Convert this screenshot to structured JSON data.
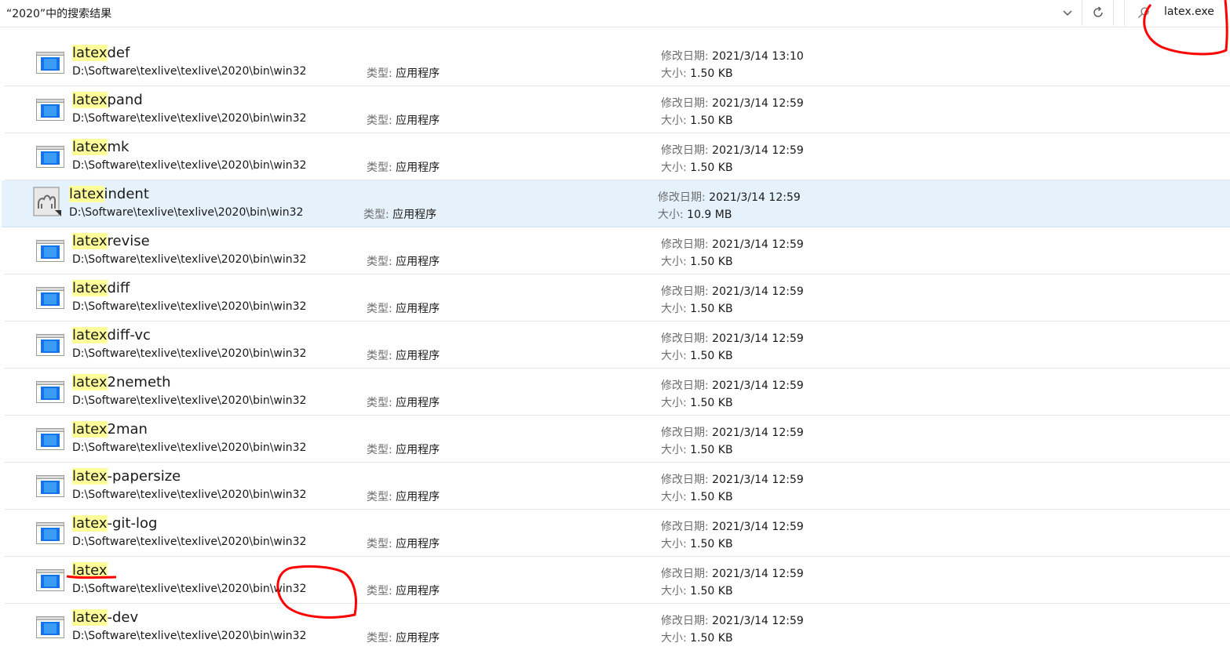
{
  "address_bar": {
    "title": "“2020”中的搜索结果"
  },
  "search": {
    "query": "latex.exe"
  },
  "labels": {
    "type": "类型:",
    "date": "修改日期:",
    "size": "大小:"
  },
  "search_term": "latex",
  "files": [
    {
      "highlight": "latex",
      "suffix": "def",
      "path": "D:\\Software\\texlive\\texlive\\2020\\bin\\win32",
      "type": "应用程序",
      "date": "2021/3/14 13:10",
      "size": "1.50 KB",
      "icon": "application-icon"
    },
    {
      "highlight": "latex",
      "suffix": "pand",
      "path": "D:\\Software\\texlive\\texlive\\2020\\bin\\win32",
      "type": "应用程序",
      "date": "2021/3/14 12:59",
      "size": "1.50 KB",
      "icon": "application-icon"
    },
    {
      "highlight": "latex",
      "suffix": "mk",
      "path": "D:\\Software\\texlive\\texlive\\2020\\bin\\win32",
      "type": "应用程序",
      "date": "2021/3/14 12:59",
      "size": "1.50 KB",
      "icon": "application-icon"
    },
    {
      "highlight": "latex",
      "suffix": "indent",
      "path": "D:\\Software\\texlive\\texlive\\2020\\bin\\win32",
      "type": "应用程序",
      "date": "2021/3/14 12:59",
      "size": "10.9 MB",
      "icon": "camel-icon",
      "selected": true
    },
    {
      "highlight": "latex",
      "suffix": "revise",
      "path": "D:\\Software\\texlive\\texlive\\2020\\bin\\win32",
      "type": "应用程序",
      "date": "2021/3/14 12:59",
      "size": "1.50 KB",
      "icon": "application-icon"
    },
    {
      "highlight": "latex",
      "suffix": "diff",
      "path": "D:\\Software\\texlive\\texlive\\2020\\bin\\win32",
      "type": "应用程序",
      "date": "2021/3/14 12:59",
      "size": "1.50 KB",
      "icon": "application-icon"
    },
    {
      "highlight": "latex",
      "suffix": "diff-vc",
      "path": "D:\\Software\\texlive\\texlive\\2020\\bin\\win32",
      "type": "应用程序",
      "date": "2021/3/14 12:59",
      "size": "1.50 KB",
      "icon": "application-icon"
    },
    {
      "highlight": "latex",
      "suffix": "2nemeth",
      "path": "D:\\Software\\texlive\\texlive\\2020\\bin\\win32",
      "type": "应用程序",
      "date": "2021/3/14 12:59",
      "size": "1.50 KB",
      "icon": "application-icon"
    },
    {
      "highlight": "latex",
      "suffix": "2man",
      "path": "D:\\Software\\texlive\\texlive\\2020\\bin\\win32",
      "type": "应用程序",
      "date": "2021/3/14 12:59",
      "size": "1.50 KB",
      "icon": "application-icon"
    },
    {
      "highlight": "latex",
      "suffix": "-papersize",
      "path": "D:\\Software\\texlive\\texlive\\2020\\bin\\win32",
      "type": "应用程序",
      "date": "2021/3/14 12:59",
      "size": "1.50 KB",
      "icon": "application-icon"
    },
    {
      "highlight": "latex",
      "suffix": "-git-log",
      "path": "D:\\Software\\texlive\\texlive\\2020\\bin\\win32",
      "type": "应用程序",
      "date": "2021/3/14 12:59",
      "size": "1.50 KB",
      "icon": "application-icon"
    },
    {
      "highlight": "latex",
      "suffix": "",
      "path": "D:\\Software\\texlive\\texlive\\2020\\bin\\win32",
      "type": "应用程序",
      "date": "2021/3/14 12:59",
      "size": "1.50 KB",
      "icon": "application-icon"
    },
    {
      "highlight": "latex",
      "suffix": "-dev",
      "path": "D:\\Software\\texlive\\texlive\\2020\\bin\\win32",
      "type": "应用程序",
      "date": "2021/3/14 12:59",
      "size": "1.50 KB",
      "icon": "application-icon"
    }
  ],
  "colors": {
    "highlight": "#ffff99",
    "selection": "#e5f1fb",
    "annotation": "#ff0000"
  }
}
